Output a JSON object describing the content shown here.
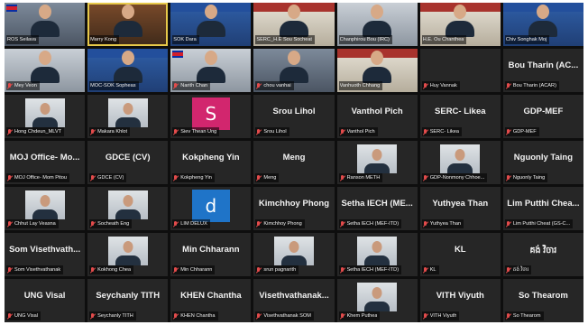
{
  "meeting": {
    "tiles": [
      {
        "name": "ROS Seilava",
        "kind": "video",
        "style": "v1",
        "muted": false
      },
      {
        "name": "Marry Kong",
        "kind": "video",
        "style": "v5",
        "muted": false,
        "active": true
      },
      {
        "name": "SOK Dara",
        "kind": "video",
        "style": "v4",
        "muted": false
      },
      {
        "name": "SERC_H.E Sou Socheat",
        "kind": "video",
        "style": "v3",
        "muted": false
      },
      {
        "name": "Chanphirou Bou (IRC)",
        "kind": "video",
        "style": "v2",
        "muted": false
      },
      {
        "name": "H.E. Ou Chanthea",
        "kind": "video",
        "style": "v3",
        "muted": false
      },
      {
        "name": "Chiv Songhak Moj",
        "kind": "video",
        "style": "v4",
        "muted": false
      },
      {
        "name": "Mey Veon",
        "kind": "video",
        "style": "v2",
        "muted": true
      },
      {
        "name": "MOC-SOK Sopheas",
        "kind": "video",
        "style": "v4",
        "muted": false
      },
      {
        "name": "Narith Chan",
        "kind": "video",
        "style": "v2",
        "muted": true
      },
      {
        "name": "chou vanhai",
        "kind": "video",
        "style": "v1",
        "muted": true
      },
      {
        "name": "Vanhuoth Chhang",
        "kind": "video",
        "style": "v3",
        "muted": false
      },
      {
        "name": "Huy Vannak",
        "kind": "blank",
        "muted": true
      },
      {
        "name": "Bou Tharin (ACAR)",
        "kind": "text",
        "big": "Bou Tharin (AC...",
        "muted": true
      },
      {
        "name": "Hong Chdeun_MLVT",
        "kind": "thumb",
        "muted": true
      },
      {
        "name": "Makara Khlot",
        "kind": "thumb",
        "muted": true
      },
      {
        "name": "Siev Thean Ung",
        "kind": "avatar",
        "letter": "S",
        "color": "s",
        "muted": true
      },
      {
        "name": "Srou Lihol",
        "kind": "text",
        "big": "Srou Lihol",
        "muted": true
      },
      {
        "name": "Vanthol Pich",
        "kind": "text",
        "big": "Vanthol Pich",
        "muted": true
      },
      {
        "name": "SERC- Likea",
        "kind": "text",
        "big": "SERC- Likea",
        "muted": true
      },
      {
        "name": "GDP-MEF",
        "kind": "text",
        "big": "GDP-MEF",
        "muted": true
      },
      {
        "name": "MOJ Office- Mom Pitou",
        "kind": "text",
        "big": "MOJ Office- Mo...",
        "muted": true
      },
      {
        "name": "GDCE (CV)",
        "kind": "text",
        "big": "GDCE (CV)",
        "muted": true
      },
      {
        "name": "Kokpheng Yin",
        "kind": "text",
        "big": "Kokpheng Yin",
        "muted": true
      },
      {
        "name": "Meng",
        "kind": "text",
        "big": "Meng",
        "muted": true
      },
      {
        "name": "Ranson METH",
        "kind": "thumb",
        "muted": true
      },
      {
        "name": "GDP-Nonmony Chhoe...",
        "kind": "thumb",
        "muted": true
      },
      {
        "name": "Nguonly Taing",
        "kind": "text",
        "big": "Nguonly Taing",
        "muted": true
      },
      {
        "name": "Chhut Lay Veasna",
        "kind": "thumb",
        "muted": true
      },
      {
        "name": "Socheath Eng",
        "kind": "thumb",
        "muted": true
      },
      {
        "name": "LIM DELUX",
        "kind": "avatar",
        "letter": "d",
        "color": "d",
        "muted": true
      },
      {
        "name": "Kimchhoy Phong",
        "kind": "text",
        "big": "Kimchhoy Phong",
        "muted": true
      },
      {
        "name": "Setha IECH (MEF-ITD)",
        "kind": "text",
        "big": "Setha IECH (ME...",
        "muted": true
      },
      {
        "name": "Yuthyea Than",
        "kind": "text",
        "big": "Yuthyea Than",
        "muted": true
      },
      {
        "name": "Lim Putthi Cheat (GS-C...",
        "kind": "text",
        "big": "Lim Putthi Chea...",
        "muted": true
      },
      {
        "name": "Som Visethvathanak",
        "kind": "text",
        "big": "Som Visethvath...",
        "muted": true
      },
      {
        "name": "Kokhong Chea",
        "kind": "thumb",
        "muted": true
      },
      {
        "name": "Min Chharann",
        "kind": "text",
        "big": "Min Chharann",
        "muted": true
      },
      {
        "name": "srun pagnarith",
        "kind": "thumb",
        "muted": true
      },
      {
        "name": "Setha IECH (MEF-ITD)",
        "kind": "thumb",
        "muted": true
      },
      {
        "name": "KL",
        "kind": "text",
        "big": "KL",
        "muted": true
      },
      {
        "name": "គង់ វិចារ",
        "kind": "text",
        "big": "គង់ វិចារ",
        "muted": true
      },
      {
        "name": "UNG Visal",
        "kind": "text",
        "big": "UNG Visal",
        "muted": true
      },
      {
        "name": "Seychanly TITH",
        "kind": "text",
        "big": "Seychanly TITH",
        "muted": true
      },
      {
        "name": "KHEN Chantha",
        "kind": "text",
        "big": "KHEN Chantha",
        "muted": true
      },
      {
        "name": "Visethvathanak SOM",
        "kind": "text",
        "big": "Visethvathanak...",
        "muted": true
      },
      {
        "name": "Khem Puthea",
        "kind": "thumb",
        "muted": true
      },
      {
        "name": "VITH Viyuth",
        "kind": "text",
        "big": "VITH Viyuth",
        "muted": true
      },
      {
        "name": "So Thearom",
        "kind": "text",
        "big": "So Thearom",
        "muted": true
      }
    ]
  }
}
